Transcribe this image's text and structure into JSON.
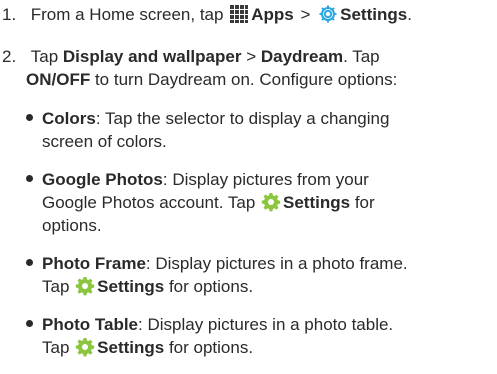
{
  "step1": {
    "number": "1.",
    "prefix": "From a Home screen, tap",
    "apps_icon": "apps-grid-icon",
    "apps": "Apps",
    "separator": ">",
    "settings_icon": "settings-gear-icon",
    "settings": "Settings",
    "period": "."
  },
  "step2": {
    "number": "2.",
    "tap_word": "Tap",
    "display_wallpaper": "Display and wallpaper",
    "separator": ">",
    "daydream": "Daydream",
    "period_tap": ". Tap",
    "onoff": "ON/OFF",
    "line2_rest": "to turn Daydream on. Configure options:"
  },
  "options": [
    {
      "name": "Colors",
      "line1": ": Tap the selector to display a changing",
      "line2": "screen of colors."
    },
    {
      "name": "Google Photos",
      "line1": ": Display pictures from your",
      "line2": "Google Photos account. Tap",
      "settings": "Settings",
      "line2_end": "for",
      "line3": "options."
    },
    {
      "name": "Photo Frame",
      "line1": ": Display pictures in a photo frame.",
      "tap": "Tap",
      "settings": "Settings",
      "line2_end": "for options."
    },
    {
      "name": "Photo Table",
      "line1": ": Display pictures in a photo table.",
      "tap": "Tap",
      "settings": "Settings",
      "line2_end": "for options."
    }
  ],
  "icons": {
    "apps": "apps-grid-icon",
    "settings_blue": "settings-gear-icon",
    "settings_green": "gear-icon"
  },
  "colors": {
    "text": "#2a2a2a",
    "settings_blue": "#2aa7e0",
    "gear_green": "#8cc63f"
  }
}
